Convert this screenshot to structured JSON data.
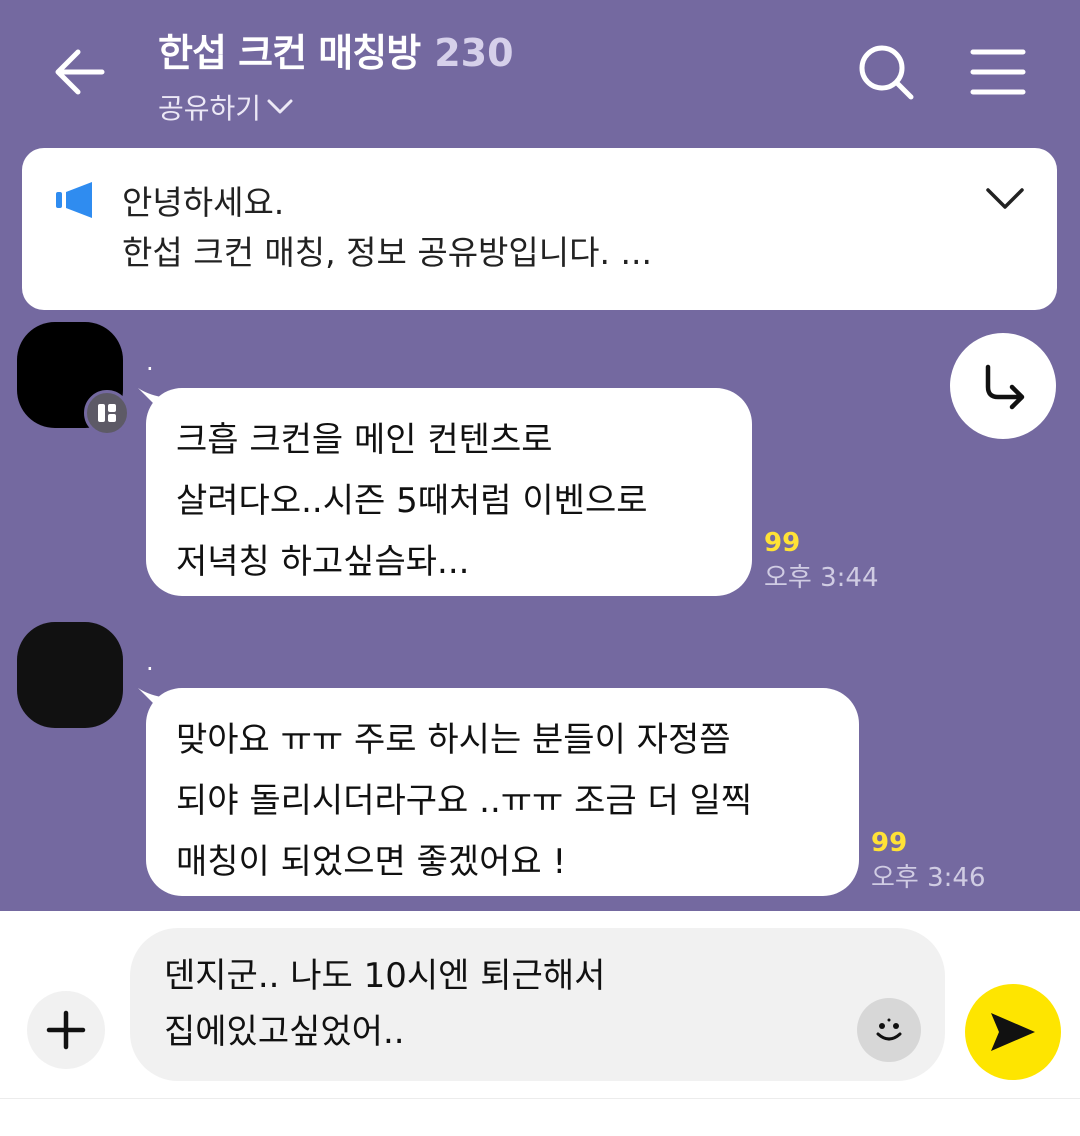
{
  "header": {
    "title": "한섭 크컨 매칭방",
    "member_count": "230",
    "share_label": "공유하기"
  },
  "notice": {
    "line1": "안녕하세요.",
    "line2": "한섭 크컨 매칭, 정보 공유방입니다. ..."
  },
  "messages": [
    {
      "sender": ".",
      "text": "크흡 크컨을 메인 컨텐츠로\n살려다오..시즌 5때처럼 이벤으로\n저녁칭 하고싶슴돠...",
      "unread": "99",
      "time": "오후 3:44"
    },
    {
      "sender": ".",
      "text": "맞아요 ㅠㅠ 주로 하시는 분들이 자정쯤\n되야 돌리시더라구요 ..ㅠㅠ 조금 더 일찍\n매칭이 되었으면 좋겠어요 !",
      "unread": "99",
      "time": "오후 3:46"
    }
  ],
  "input": {
    "value": "덴지군.. 나도 10시엔 퇴근해서\n집에있고싶었어.."
  },
  "colors": {
    "background": "#7469a0",
    "send_button": "#fee500",
    "unread": "#ffe236",
    "notice_icon": "#2f8cf0"
  },
  "icons": {
    "back": "arrow-left-icon",
    "search": "search-icon",
    "menu": "hamburger-menu-icon",
    "notice": "megaphone-icon",
    "share": "share-arrow-icon",
    "add": "plus-icon",
    "emoji": "smiley-icon",
    "send": "send-icon"
  }
}
